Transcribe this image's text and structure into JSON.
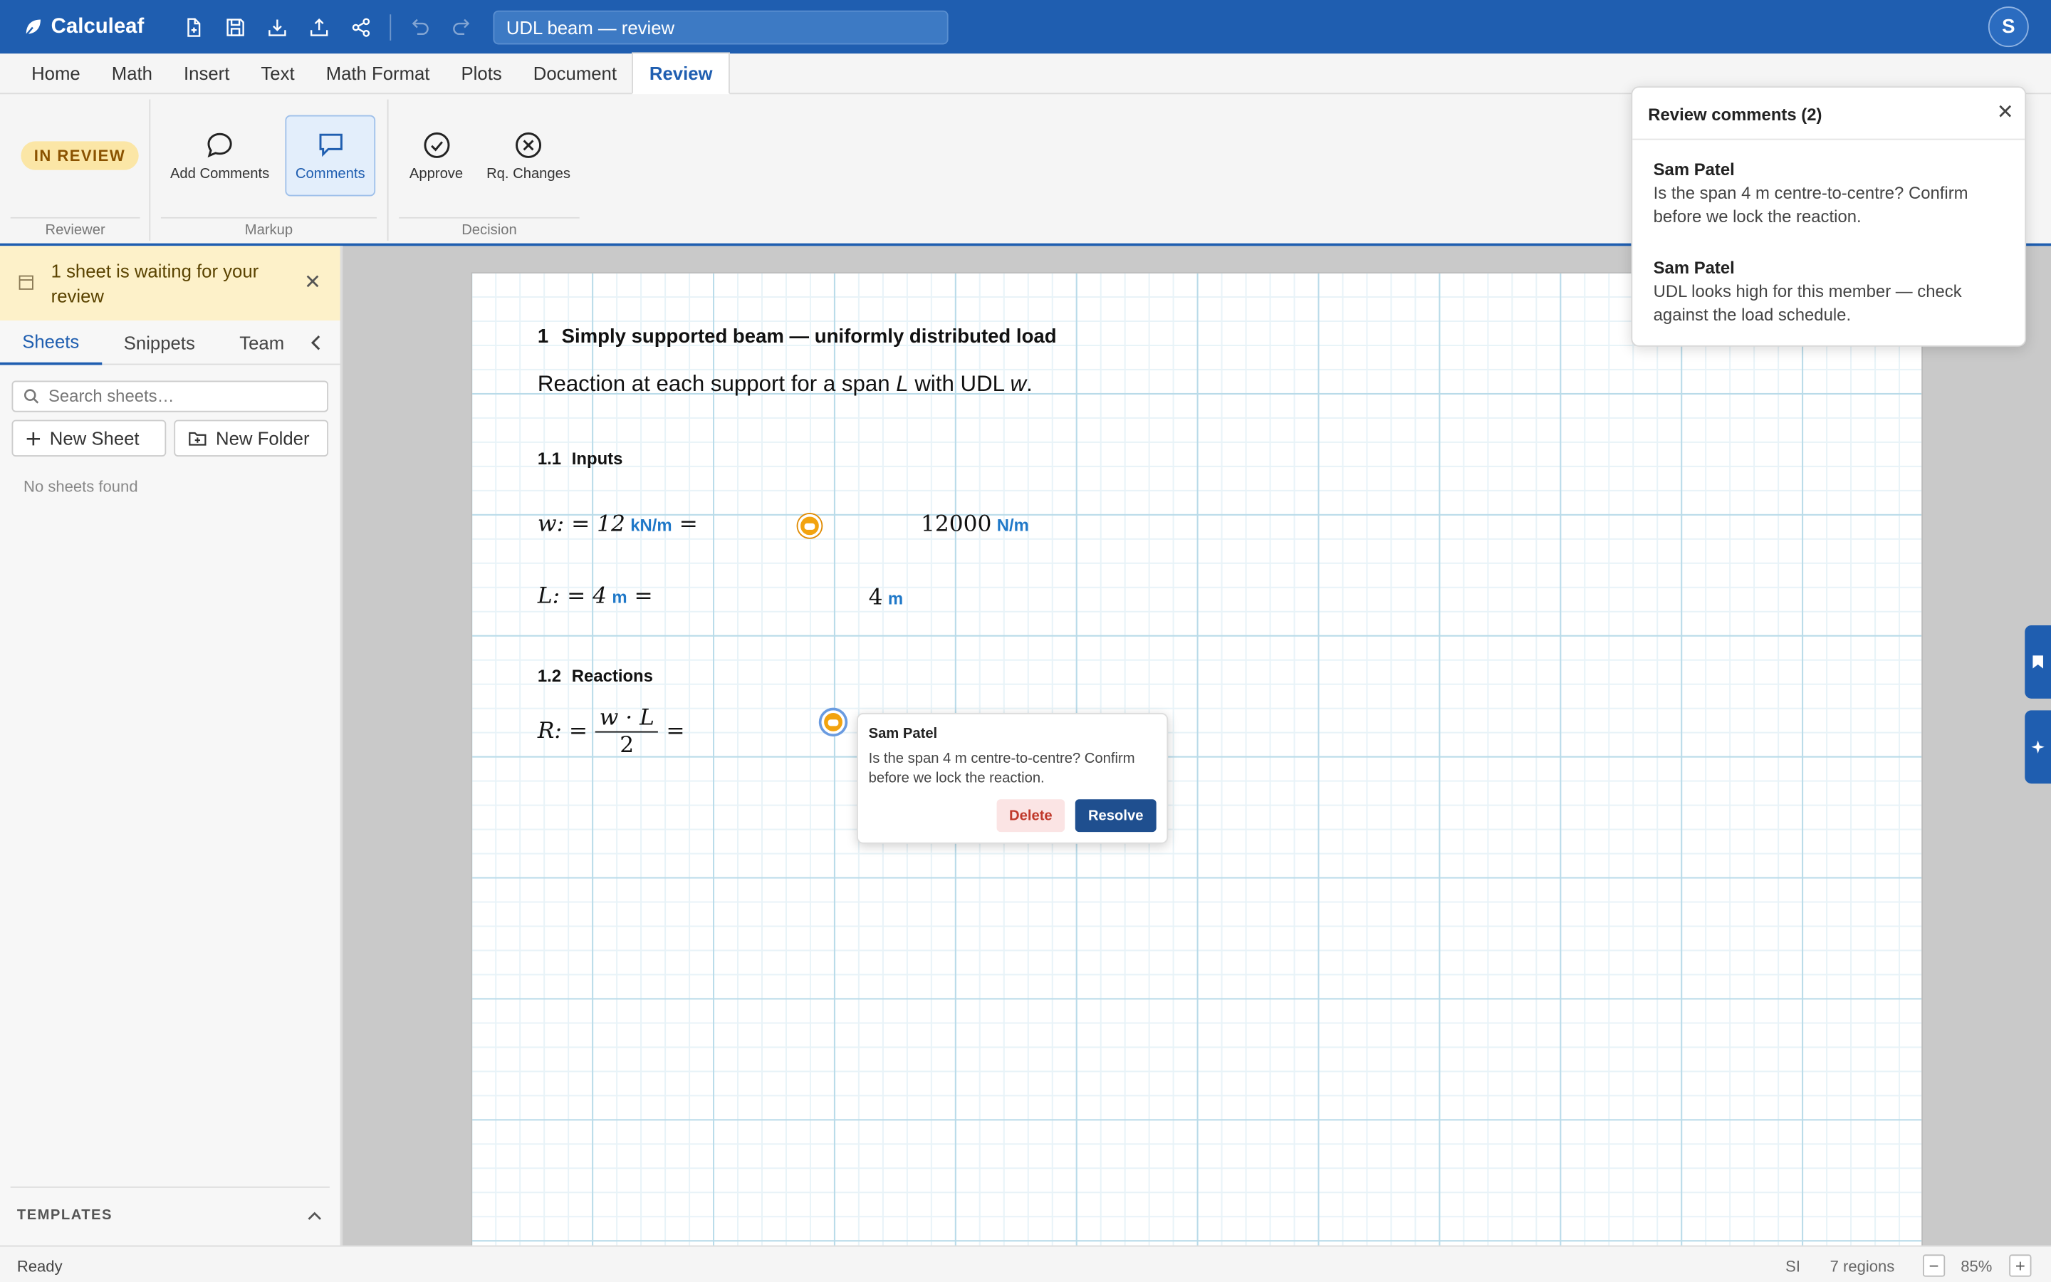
{
  "app": {
    "name": "Calculeaf",
    "doc_title": "UDL beam — review",
    "avatar_initial": "S"
  },
  "toolbar_icons": [
    "new-file-icon",
    "save-icon",
    "download-icon",
    "upload-icon",
    "share-icon",
    "undo-icon",
    "redo-icon"
  ],
  "menu": {
    "tabs": [
      {
        "label": "Home"
      },
      {
        "label": "Math"
      },
      {
        "label": "Insert"
      },
      {
        "label": "Text"
      },
      {
        "label": "Math Format"
      },
      {
        "label": "Plots"
      },
      {
        "label": "Document"
      },
      {
        "label": "Review",
        "active": true
      }
    ]
  },
  "ribbon": {
    "reviewer": {
      "badge": "IN REVIEW",
      "label": "Reviewer"
    },
    "markup": {
      "label": "Markup",
      "add_comments": "Add Comments",
      "comments": "Comments"
    },
    "decision": {
      "label": "Decision",
      "approve": "Approve",
      "request_changes": "Rq. Changes"
    }
  },
  "sidebar": {
    "notice": "1 sheet is waiting for your review",
    "tabs": [
      {
        "label": "Sheets",
        "active": true
      },
      {
        "label": "Snippets"
      },
      {
        "label": "Team"
      }
    ],
    "search_placeholder": "Search sheets…",
    "new_sheet": "New Sheet",
    "new_folder": "New Folder",
    "empty": "No sheets found",
    "templates": "TEMPLATES"
  },
  "sheet": {
    "h1": {
      "num": "1",
      "text": "Simply supported beam — uniformly distributed load"
    },
    "intro": {
      "pre": "Reaction at each support for a span ",
      "var1": "L",
      "mid": " with UDL ",
      "var2": "w",
      "post": "."
    },
    "inputs": {
      "num": "1.1",
      "text": "Inputs"
    },
    "w_def": {
      "lhs": "w: = 12",
      "unit": "kN/m",
      "eq": "=",
      "result": "12000",
      "result_unit": "N/m"
    },
    "L_def": {
      "lhs": "L: = 4",
      "unit": "m",
      "eq": "=",
      "result": "4",
      "result_unit": "m"
    },
    "reactions": {
      "num": "1.2",
      "text": "Reactions"
    },
    "R_def": {
      "lhs": "R: =",
      "num": "w · L",
      "den": "2",
      "eq": "="
    }
  },
  "popup": {
    "author": "Sam Patel",
    "body": "Is the span 4 m centre-to-centre? Confirm before we lock the reaction.",
    "delete": "Delete",
    "resolve": "Resolve"
  },
  "review_panel": {
    "title": "Review comments (2)",
    "comments": [
      {
        "author": "Sam Patel",
        "text": "Is the span 4 m centre-to-centre? Confirm before we lock the reaction."
      },
      {
        "author": "Sam Patel",
        "text": "UDL looks high for this member — check against the load schedule."
      }
    ]
  },
  "status": {
    "ready": "Ready",
    "units": "SI",
    "regions": "7 regions",
    "zoom": "85%"
  }
}
